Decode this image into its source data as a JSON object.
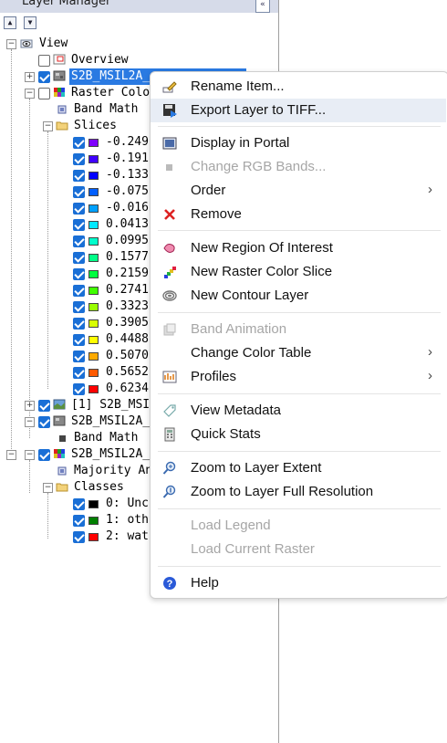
{
  "panel": {
    "title": "Layer Manager",
    "pin_label": "«",
    "collapse_all": "▲",
    "expand_all": "▼"
  },
  "tree": {
    "view": "View",
    "overview": "Overview",
    "layer1": "S2B_MSIL2A_",
    "raster_color_slice": "Raster Colo",
    "band_math": "Band Math",
    "slices_folder": "Slices",
    "slices": [
      {
        "label": "-0.249",
        "color": "#7f00ff"
      },
      {
        "label": "-0.191",
        "color": "#3f00ff"
      },
      {
        "label": "-0.133",
        "color": "#0000ff"
      },
      {
        "label": "-0.075",
        "color": "#005fff"
      },
      {
        "label": "-0.016",
        "color": "#00a0ff"
      },
      {
        "label": "0.0413",
        "color": "#00e8ff"
      },
      {
        "label": "0.0995",
        "color": "#00ffcc"
      },
      {
        "label": "0.1577",
        "color": "#00ff88"
      },
      {
        "label": "0.2159",
        "color": "#00ff40"
      },
      {
        "label": "0.2741",
        "color": "#40ff00"
      },
      {
        "label": "0.3323",
        "color": "#9aff00"
      },
      {
        "label": "0.3905",
        "color": "#d8ff00"
      },
      {
        "label": "0.4488",
        "color": "#ffff00"
      },
      {
        "label": "0.5070",
        "color": "#ffaa00"
      },
      {
        "label": "0.5652",
        "color": "#ff5a00"
      },
      {
        "label": "0.6234",
        "color": "#ff0000"
      }
    ],
    "layer_ms": "[1] S2B_MSI",
    "layer3": "S2B_MSIL2A_",
    "band_math2": "Band Math",
    "layer4": "S2B_MSIL2A_",
    "majority": "Majority An",
    "classes_folder": "Classes",
    "classes": [
      {
        "label": "0: Unc",
        "color": "#000000"
      },
      {
        "label": "1: oth",
        "color": "#008000"
      },
      {
        "label": "2: wat",
        "color": "#ff0000"
      }
    ]
  },
  "menu": {
    "rename": "Rename Item...",
    "export_tiff": "Export Layer to TIFF...",
    "display_portal": "Display in Portal",
    "change_rgb": "Change RGB Bands...",
    "order": "Order",
    "remove": "Remove",
    "new_roi": "New Region Of Interest",
    "new_slice": "New Raster Color Slice",
    "new_contour": "New Contour Layer",
    "band_animation": "Band Animation",
    "change_color_table": "Change Color Table",
    "profiles": "Profiles",
    "view_metadata": "View Metadata",
    "quick_stats": "Quick Stats",
    "zoom_extent": "Zoom to Layer Extent",
    "zoom_full_res": "Zoom to Layer Full Resolution",
    "load_legend": "Load Legend",
    "load_current_raster": "Load Current Raster",
    "help": "Help",
    "submenu_arrow": "›"
  }
}
